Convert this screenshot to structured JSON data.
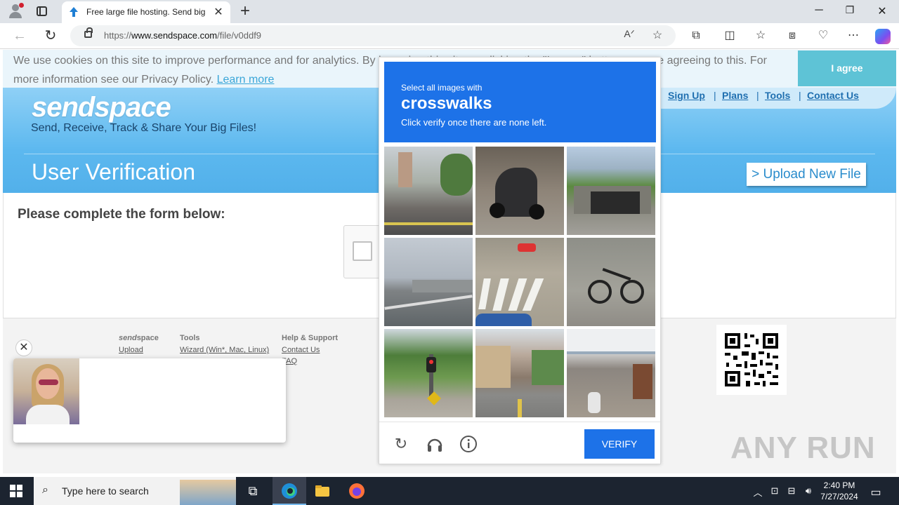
{
  "browser": {
    "tab_title": "Free large file hosting. Send big f",
    "url_prefix": "https://",
    "url_domain": "www.sendspace.com",
    "url_path": "/file/v0ddf9"
  },
  "cookie": {
    "text": "We use cookies on this site to improve performance and for analytics. By browsing this site, or clicking the \"I agree\" button, you are agreeing to this. For more information see our Privacy Policy.",
    "learn_more": "Learn more",
    "agree": "I agree"
  },
  "header": {
    "logo": "sendspace",
    "tagline": "Send, Receive, Track & Share Your Big Files!",
    "nav": [
      "Sign Up",
      "Plans",
      "Tools",
      "Contact Us"
    ],
    "page_title": "User Verification",
    "upload_button": "> Upload New File"
  },
  "form": {
    "title": "Please complete the form below:"
  },
  "footer": {
    "col1_title_a": "send",
    "col1_title_b": "space",
    "col1_links": [
      "Upload"
    ],
    "col2_title": "Tools",
    "col2_links": [
      "Wizard (Win*, Mac, Linux)"
    ],
    "col3_title": "Help & Support",
    "col3_links": [
      "Contact Us",
      "FAQ"
    ],
    "watermark": "ANY RUN"
  },
  "captcha": {
    "prompt_pre": "Select all images with",
    "prompt_word": "crosswalks",
    "prompt_sub": "Click verify once there are none left.",
    "verify": "VERIFY"
  },
  "taskbar": {
    "search_placeholder": "Type here to search",
    "time": "2:40 PM",
    "date": "7/27/2024"
  },
  "colors": {
    "accent": "#1d72e8",
    "sendspace_blue": "#5cb8ef",
    "agree_button": "#5ec3d6"
  }
}
